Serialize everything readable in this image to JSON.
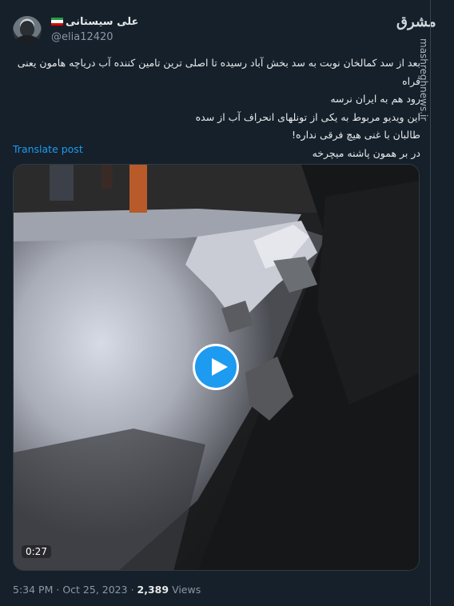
{
  "author": {
    "display_name": "علی سیستانی",
    "handle": "@elia12420",
    "flag_icon": "iran-flag-icon"
  },
  "watermark": {
    "logo_text": "مشرق",
    "url": "mashreghnews.ir"
  },
  "tweet": {
    "lines": [
      "بعد از سد کمالخان نوبت به سد بخش آباد رسیده تا اصلی ترین تامین کننده آب دریاچه هامون یعنی فراه",
      "رود هم به ایران نرسه",
      "این ویدیو مربوط به یکی از تونلهای انحراف آب از سده",
      "طالبان با غنی هیچ فرقی نداره!",
      "در بر همون پاشنه میچرخه"
    ],
    "translate_label": "Translate post"
  },
  "video": {
    "duration": "0:27",
    "play_icon": "play-icon"
  },
  "footer": {
    "time": "5:34 PM",
    "separator": "·",
    "date": "Oct 25, 2023",
    "views_count": "2,389",
    "views_label": "Views"
  },
  "colors": {
    "background": "#15202b",
    "accent": "#1d9bf0",
    "text": "#e7e9ea",
    "muted": "#8b98a5"
  }
}
